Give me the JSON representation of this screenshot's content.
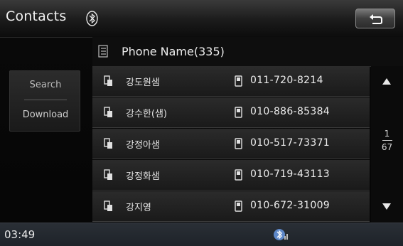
{
  "header": {
    "title": "Contacts",
    "bluetooth_icon": "bluetooth-icon",
    "back_icon": "back-arrow-icon"
  },
  "list": {
    "title": "Phone Name(335)",
    "icon": "phonebook-icon"
  },
  "side": {
    "search_label": "Search",
    "download_label": "Download"
  },
  "contacts": [
    {
      "name": "강도원샘",
      "number": "011-720-8214"
    },
    {
      "name": "강수한(샘)",
      "number": "010-886-85384"
    },
    {
      "name": "강정아샘",
      "number": "010-517-73371"
    },
    {
      "name": "강정화샘",
      "number": "010-719-43113"
    },
    {
      "name": "강지영",
      "number": "010-672-31009"
    }
  ],
  "scroll": {
    "current_page": "1",
    "total_pages": "67"
  },
  "footer": {
    "time": "03:49"
  },
  "colors": {
    "background": "#000000",
    "row": "#232323",
    "footer": "#23282e"
  }
}
